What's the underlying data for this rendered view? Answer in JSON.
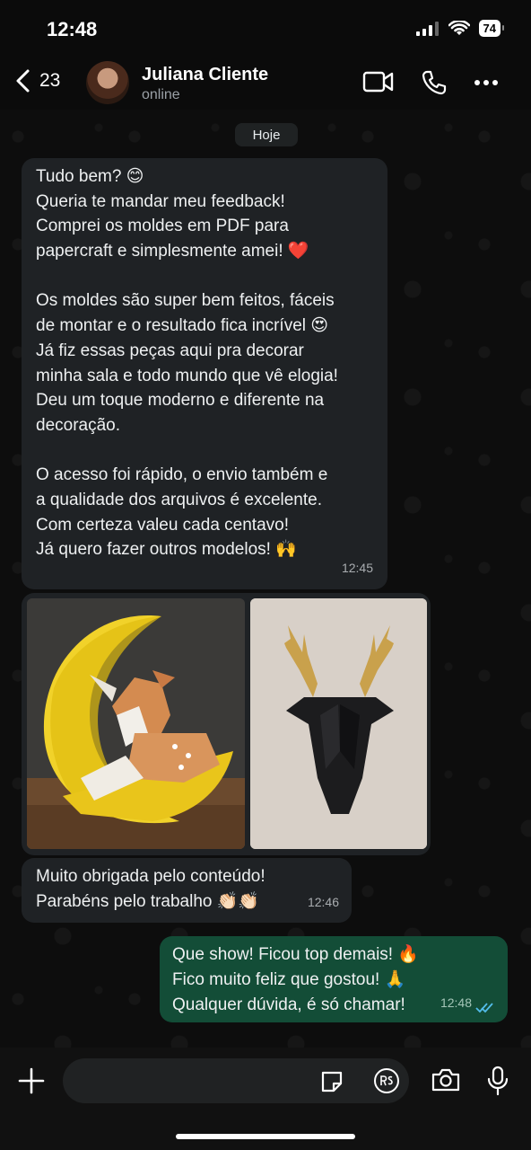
{
  "status_bar": {
    "time": "12:48",
    "battery": "74"
  },
  "header": {
    "back_count": "23",
    "contact_name": "Juliana Cliente",
    "contact_status": "online"
  },
  "date_chip": "Hoje",
  "messages": [
    {
      "direction": "incoming",
      "lines": [
        "Tudo bem? 😊",
        "Queria te mandar meu feedback!",
        "Comprei os moldes em PDF para",
        "papercraft e simplesmente amei! ❤️",
        "",
        "Os moldes são super bem feitos, fáceis",
        "de montar e o resultado fica incrível 😍",
        "Já fiz essas peças aqui pra decorar",
        "minha sala e todo mundo que vê elogia!",
        "Deu um toque moderno e diferente na",
        "decoração.",
        "",
        "O acesso foi rápido, o envio também e",
        "a qualidade dos arquivos é excelente.",
        "Com certeza valeu cada centavo!",
        "Já quero fazer outros modelos! 🙌"
      ],
      "time": "12:45"
    },
    {
      "direction": "incoming",
      "type": "images",
      "images": [
        "papercraft-deer-on-moon-photo",
        "papercraft-black-deer-head-gold-antlers-photo"
      ]
    },
    {
      "direction": "incoming",
      "lines": [
        "Muito obrigada pelo conteúdo!",
        "Parabéns pelo trabalho 👏🏻👏🏻"
      ],
      "time": "12:46"
    },
    {
      "direction": "outgoing",
      "lines": [
        "Que show! Ficou top demais! 🔥",
        "Fico muito feliz que gostou! 🙏",
        "Qualquer dúvida, é só chamar!"
      ],
      "time": "12:48",
      "read": true
    }
  ],
  "composer": {
    "placeholder": ""
  },
  "icons": [
    "chevron-left-icon",
    "video-call-icon",
    "phone-icon",
    "more-icon",
    "plus-icon",
    "sticker-icon",
    "pix-icon",
    "camera-icon",
    "microphone-icon"
  ],
  "colors": {
    "incoming_bubble": "#1f2225",
    "outgoing_bubble": "#134d37",
    "read_ticks": "#53bdeb"
  }
}
